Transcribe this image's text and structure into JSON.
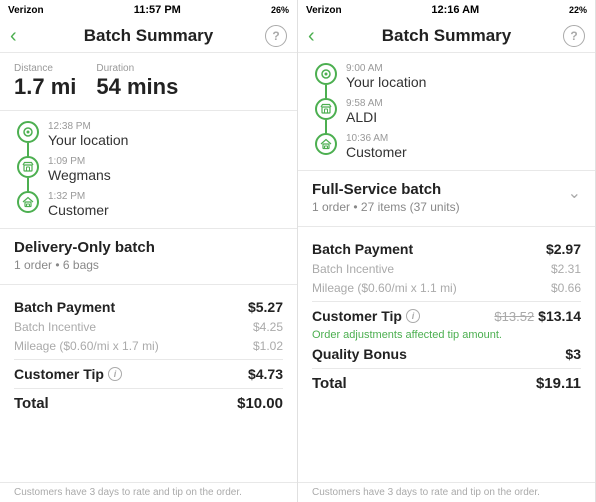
{
  "left": {
    "statusBar": {
      "carrier": "Verizon",
      "wifi": "📶",
      "time": "11:57 PM",
      "battery": "26%"
    },
    "header": {
      "title": "Batch Summary",
      "back": "‹",
      "help": "?"
    },
    "metrics": {
      "distanceLabel": "Distance",
      "distanceValue": "1.7 mi",
      "durationLabel": "Duration",
      "durationValue": "54 mins"
    },
    "timeline": [
      {
        "time": "12:38 PM",
        "label": "Your location",
        "type": "location",
        "hasLine": true
      },
      {
        "time": "1:09 PM",
        "label": "Wegmans",
        "type": "store",
        "hasLine": true
      },
      {
        "time": "1:32 PM",
        "label": "Customer",
        "type": "home",
        "hasLine": false
      }
    ],
    "batchType": {
      "title": "Delivery-Only batch",
      "subtitle": "1 order • 6 bags"
    },
    "payment": {
      "batchPaymentLabel": "Batch Payment",
      "batchPaymentValue": "$5.27",
      "batchIncentiveLabel": "Batch Incentive",
      "batchIncentiveValue": "$4.25",
      "mileageLabel": "Mileage ($0.60/mi x 1.7 mi)",
      "mileageValue": "$1.02",
      "customerTipLabel": "Customer Tip",
      "customerTipValue": "$4.73",
      "totalLabel": "Total",
      "totalValue": "$10.00"
    },
    "footer": "Customers have 3 days to rate and tip on the order."
  },
  "right": {
    "statusBar": {
      "carrier": "Verizon",
      "time": "12:16 AM",
      "battery": "22%"
    },
    "header": {
      "title": "Batch Summary",
      "back": "‹",
      "help": "?"
    },
    "timeline": [
      {
        "time": "9:00 AM",
        "label": "Your location",
        "type": "location",
        "hasLine": true
      },
      {
        "time": "9:58 AM",
        "label": "ALDI",
        "type": "store",
        "hasLine": true
      },
      {
        "time": "10:36 AM",
        "label": "Customer",
        "type": "home",
        "hasLine": false
      }
    ],
    "batchType": {
      "title": "Full-Service batch",
      "subtitle": "1 order • 27 items (37 units)"
    },
    "payment": {
      "batchPaymentLabel": "Batch Payment",
      "batchPaymentValue": "$2.97",
      "batchIncentiveLabel": "Batch Incentive",
      "batchIncentiveValue": "$2.31",
      "mileageLabel": "Mileage ($0.60/mi x 1.1 mi)",
      "mileageValue": "$0.66",
      "customerTipLabel": "Customer Tip",
      "customerTipStrikethrough": "$13.52",
      "customerTipValue": "$13.14",
      "adjustmentNote": "Order adjustments affected tip amount.",
      "qualityBonusLabel": "Quality Bonus",
      "qualityBonusValue": "$3",
      "totalLabel": "Total",
      "totalValue": "$19.11"
    },
    "footer": "Customers have 3 days to rate and tip on the order."
  },
  "icons": {
    "location": "◎",
    "store": "🏪",
    "home": "🏠",
    "back": "‹",
    "help": "?"
  }
}
